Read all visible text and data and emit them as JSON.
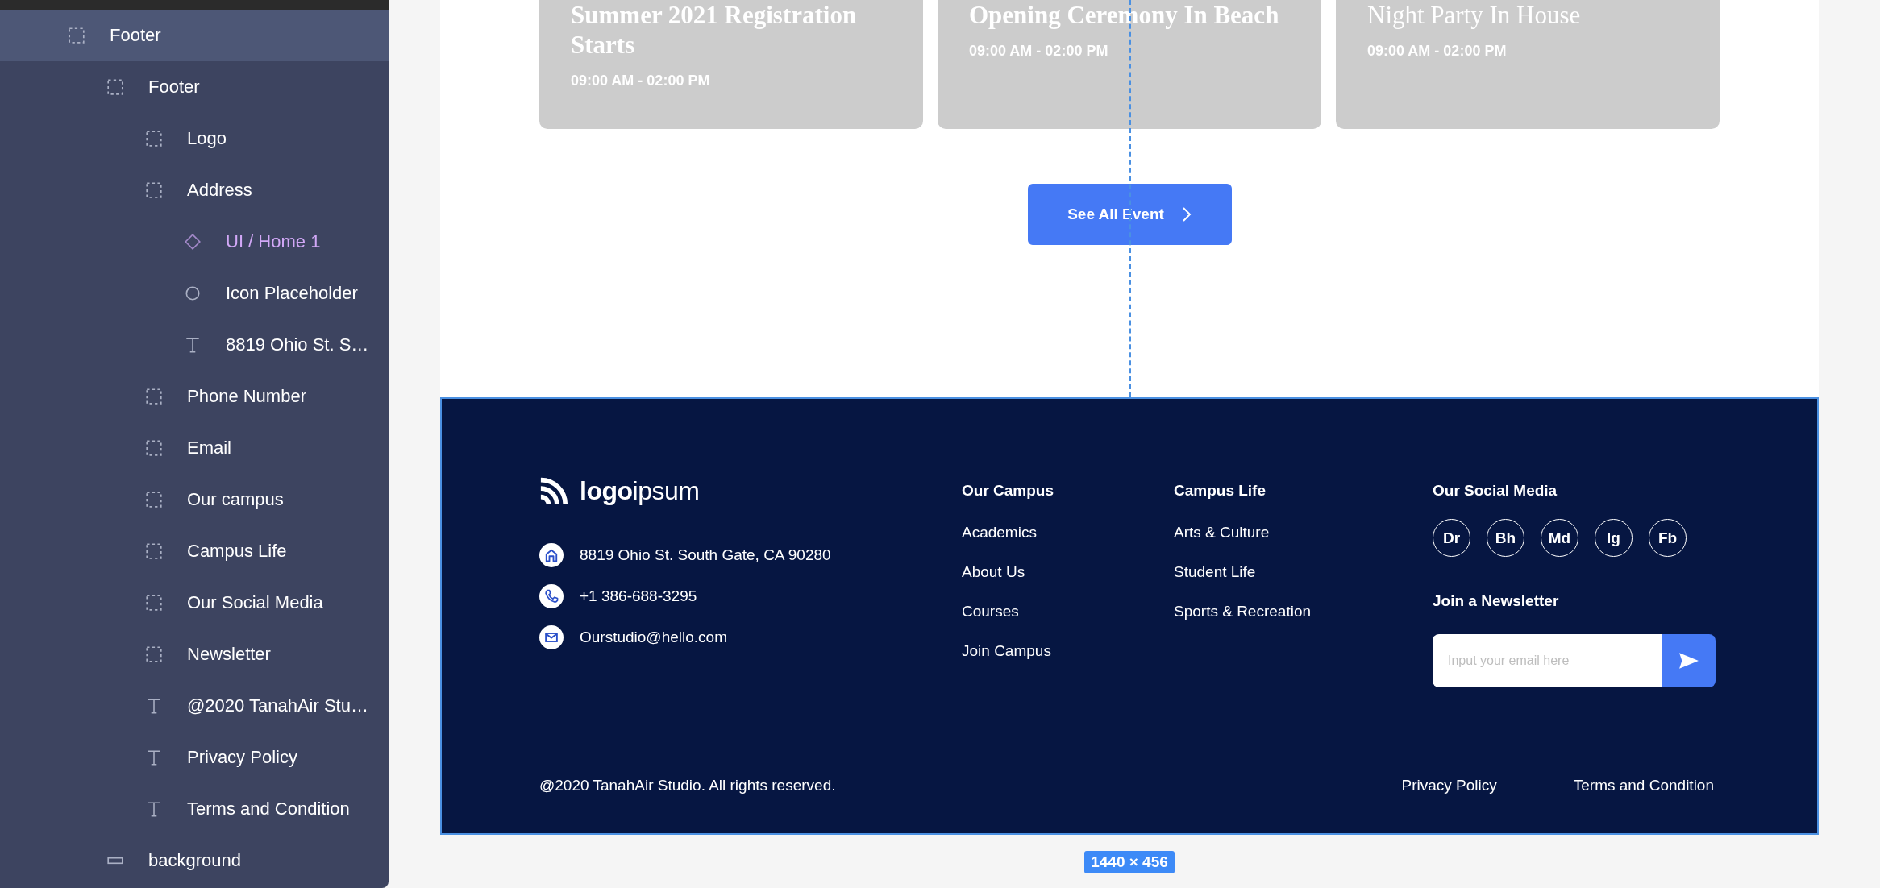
{
  "layers": [
    {
      "name": "Footer",
      "kind": "frame",
      "selected": true,
      "children": [
        {
          "name": "Footer",
          "kind": "frame",
          "selected": false,
          "children": [
            {
              "name": "Logo",
              "kind": "frame",
              "selected": false
            },
            {
              "name": "Address",
              "kind": "frame",
              "selected": false,
              "children": [
                {
                  "name": "UI / Home 1",
                  "kind": "component",
                  "selected": false
                },
                {
                  "name": "Icon Placeholder",
                  "kind": "ellipse",
                  "selected": false
                },
                {
                  "name": "8819 Ohio St. S…",
                  "kind": "text",
                  "selected": false
                }
              ]
            },
            {
              "name": "Phone Number",
              "kind": "frame",
              "selected": false
            },
            {
              "name": "Email",
              "kind": "frame",
              "selected": false
            },
            {
              "name": "Our campus",
              "kind": "frame",
              "selected": false
            },
            {
              "name": "Campus Life",
              "kind": "frame",
              "selected": false
            },
            {
              "name": "Our Social Media",
              "kind": "frame",
              "selected": false
            },
            {
              "name": "Newsletter",
              "kind": "frame",
              "selected": false
            },
            {
              "name": "@2020 TanahAir Stu…",
              "kind": "text",
              "selected": false
            },
            {
              "name": "Privacy Policy",
              "kind": "text",
              "selected": false
            },
            {
              "name": "Terms and Condition",
              "kind": "text",
              "selected": false
            }
          ]
        },
        {
          "name": "background",
          "kind": "rect",
          "selected": false
        }
      ]
    }
  ],
  "events": [
    {
      "title": "Summer 2021 Registration Starts",
      "time": "09:00 AM - 02:00 PM",
      "bold": true
    },
    {
      "title": "Opening Ceremony In Beach",
      "time": "09:00 AM - 02:00 PM",
      "bold": true
    },
    {
      "title": "Night Party In House",
      "time": "09:00 AM - 02:00 PM",
      "bold": false
    }
  ],
  "see_all_button": "See All Event",
  "footer": {
    "logo": "**logo**ipsum",
    "contacts": [
      {
        "kind": "address",
        "text": "8819 Ohio St. South Gate, CA 90280"
      },
      {
        "kind": "phone",
        "text": "+1 386-688-3295"
      },
      {
        "kind": "email",
        "text": "Ourstudio@hello.com"
      }
    ],
    "columns": [
      {
        "heading": "Our Campus",
        "links": [
          "Academics",
          "About Us",
          "Courses",
          "Join Campus"
        ]
      },
      {
        "heading": "Campus Life",
        "links": [
          "Arts & Culture",
          "Student Life",
          "Sports & Recreation"
        ]
      }
    ],
    "social_heading": "Our Social Media",
    "social": [
      "Dr",
      "Bh",
      "Md",
      "Ig",
      "Fb"
    ],
    "newsletter_heading": "Join a Newsletter",
    "newsletter": {
      "placeholder": "Input your email here"
    },
    "copyright": "@2020 TanahAir Studio. All rights reserved.",
    "bottom_links": [
      "Privacy Policy",
      "Terms and Condition"
    ]
  },
  "dimension_label": "1440 × 456"
}
